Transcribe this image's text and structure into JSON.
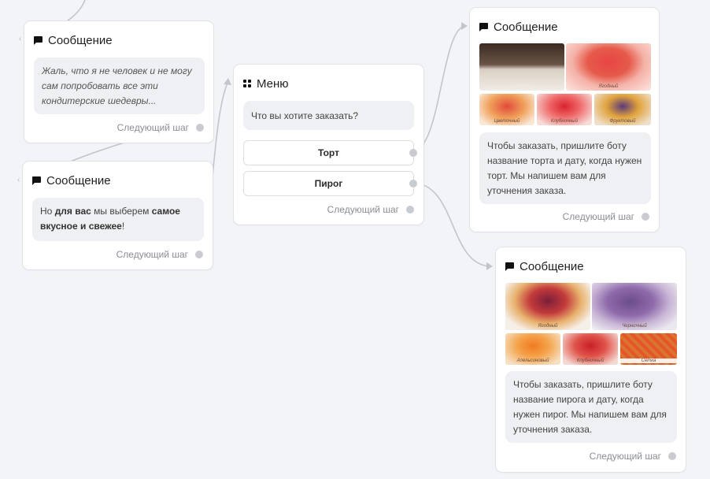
{
  "cards": {
    "msg_top_left": {
      "title": "Сообщение",
      "text": "Жаль, что я не человек и не могу сам попробовать все эти кондитерские шедевры...",
      "next": "Следующий шаг"
    },
    "msg_mid_left": {
      "title": "Сообщение",
      "text_parts": [
        "Но ",
        "для вас",
        " мы выберем ",
        "самое вкусное и свежее",
        "!"
      ],
      "next": "Следующий шаг"
    },
    "menu": {
      "title": "Меню",
      "question": "Что вы хотите заказать?",
      "buttons": [
        "Торт",
        "Пирог"
      ],
      "next": "Следующий шаг"
    },
    "msg_cake": {
      "title": "Сообщение",
      "image_captions": [
        "Свадебный",
        "Ягодный",
        "Цветочный",
        "Клубничный",
        "Фруктовый"
      ],
      "text": "Чтобы заказать, пришлите боту название торта и дату, когда нужен торт. Мы напишем вам для уточнения заказа.",
      "next": "Следующий шаг"
    },
    "msg_pie": {
      "title": "Сообщение",
      "image_captions": [
        "Ягодный",
        "Черничный",
        "Апельсиновый",
        "Клубничный",
        "Сетка"
      ],
      "text": "Чтобы заказать, пришлите боту название пирога и дату, когда нужен пирог. Мы напишем вам для уточнения заказа.",
      "next": "Следующий шаг"
    }
  },
  "colors": {
    "canvas": "#f3f4f7",
    "card_border": "#e1e3e8",
    "bubble": "#eff0f3",
    "wire": "#c3c5cc",
    "connector_dot": "#c9cbd2"
  },
  "icons": [
    "message-icon",
    "menu-grid-icon",
    "connector-dot-icon",
    "input-arrow-icon"
  ]
}
